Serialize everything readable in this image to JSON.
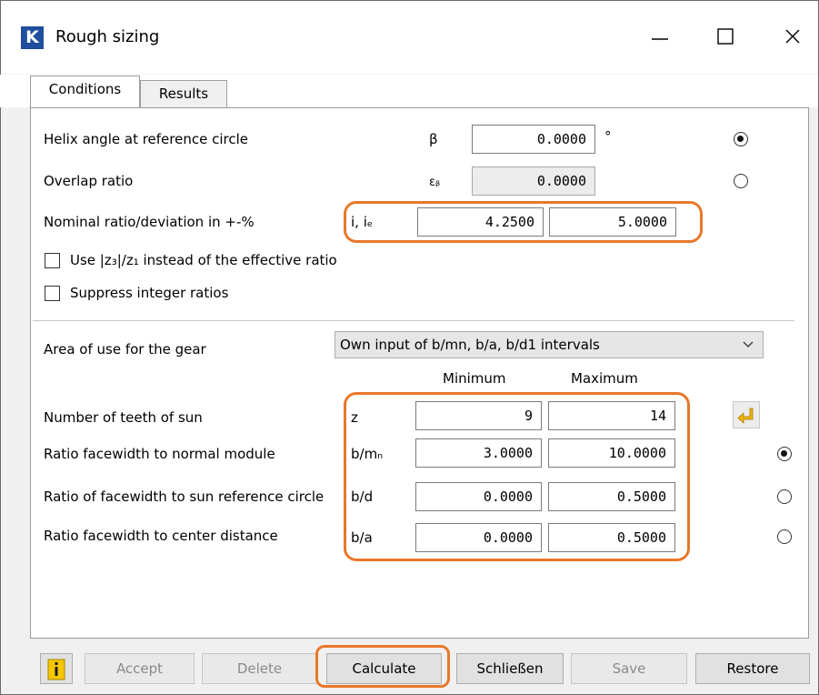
{
  "window": {
    "title": "Rough sizing",
    "logo_letter": "K",
    "controls": [
      "minimize-icon",
      "maximize-icon",
      "close-icon"
    ]
  },
  "tabs": [
    {
      "label": "Conditions",
      "active": true
    },
    {
      "label": "Results",
      "active": false
    }
  ],
  "conditions": {
    "helix": {
      "label": "Helix angle at reference circle",
      "symbol": "β",
      "value": "0.0000",
      "unit": "°",
      "selected": true
    },
    "overlap": {
      "label": "Overlap ratio",
      "symbol": "εᵦ",
      "value": "0.0000",
      "selected": false
    },
    "nominal": {
      "label": "Nominal ratio/deviation in +-%",
      "symbol": "i, iₑ",
      "ratio": "4.2500",
      "deviation": "5.0000"
    },
    "use_ratio_check": {
      "label": "Use |z₃|/z₁ instead of the effective ratio",
      "checked": false
    },
    "suppress_check": {
      "label": "Suppress integer ratios",
      "checked": false
    },
    "area": {
      "label": "Area of use for the gear",
      "value": "Own input of b/mn, b/a, b/d1 intervals"
    },
    "headers": {
      "min": "Minimum",
      "max": "Maximum"
    },
    "teeth": {
      "label": "Number of teeth of sun",
      "symbol": "z",
      "min": "9",
      "max": "14"
    },
    "b_mn": {
      "label": "Ratio facewidth to normal module",
      "symbol": "b/mₙ",
      "min": "3.0000",
      "max": "10.0000",
      "selected": true
    },
    "b_d": {
      "label": "Ratio of facewidth to sun reference circle",
      "symbol": "b/d",
      "min": "0.0000",
      "max": "0.5000",
      "selected": false
    },
    "b_a": {
      "label": "Ratio facewidth to center distance",
      "symbol": "b/a",
      "min": "0.0000",
      "max": "0.5000",
      "selected": false
    }
  },
  "buttons": {
    "info_icon": "info-icon",
    "accept": "Accept",
    "delete": "Delete",
    "calculate": "Calculate",
    "close": "Schließen",
    "save": "Save",
    "restore": "Restore"
  },
  "colors": {
    "highlight": "#e8782a",
    "logo_bg": "#1f4e9c",
    "info_icon": "#e0a800"
  }
}
